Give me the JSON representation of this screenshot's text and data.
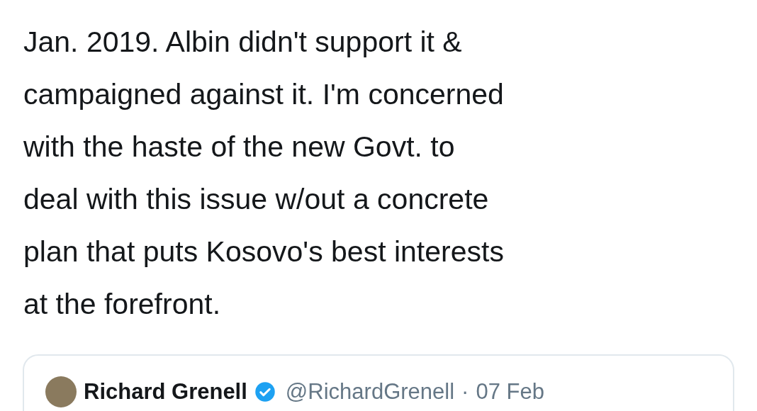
{
  "tweet": {
    "text_lines": [
      "Jan. 2019. Albin didn't support it &",
      "campaigned against it. I'm concerned",
      "with the haste of the new Govt. to",
      "deal with this issue w/out a concrete",
      "plan that puts Kosovo's best interests",
      "at the forefront."
    ]
  },
  "quoted_tweet": {
    "name": "Richard Grenell",
    "verified": true,
    "handle": "@RichardGrenell",
    "separator": "·",
    "date": "07 Feb"
  }
}
